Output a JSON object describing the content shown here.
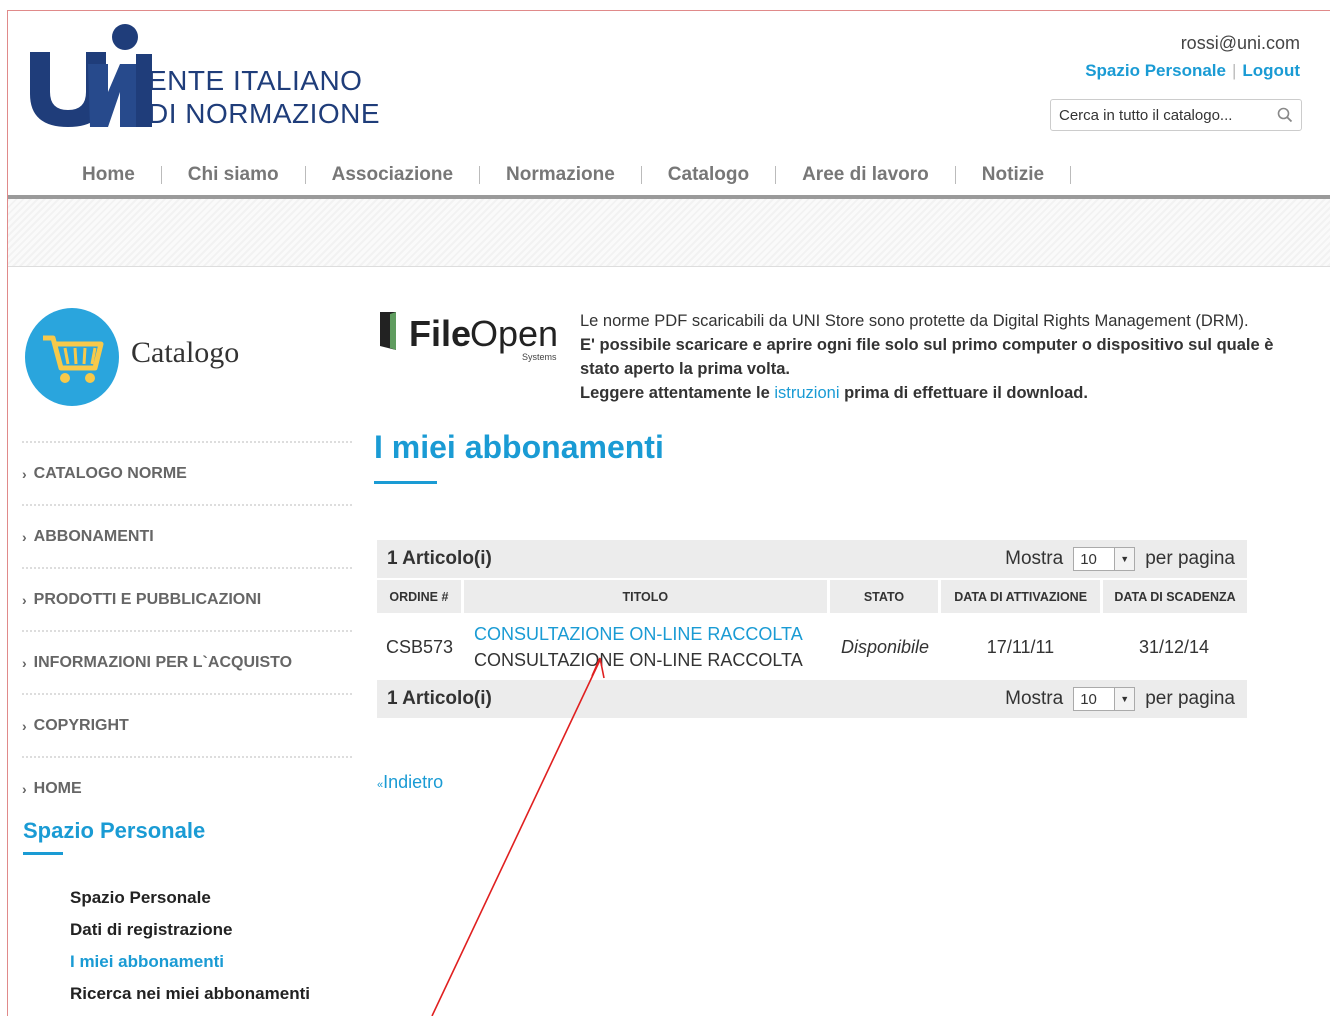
{
  "brand": {
    "line1": "ENTE ITALIANO",
    "line2": "DI NORMAZIONE",
    "brand_blue": "#1f3d7a"
  },
  "user": {
    "email": "rossi@uni.com",
    "personal_space": "Spazio Personale",
    "logout": "Logout"
  },
  "search": {
    "placeholder": "Cerca in tutto il catalogo..."
  },
  "nav": {
    "items": [
      "Home",
      "Chi siamo",
      "Associazione",
      "Normazione",
      "Catalogo",
      "Aree di lavoro",
      "Notizie"
    ]
  },
  "sidebar": {
    "catalog_title": "Catalogo",
    "menu": [
      "CATALOGO NORME",
      "ABBONAMENTI",
      "PRODOTTI E PUBBLICAZIONI",
      "INFORMAZIONI PER L`ACQUISTO",
      "COPYRIGHT",
      "HOME"
    ],
    "personal_title": "Spazio Personale",
    "personal_links": [
      "Spazio Personale",
      "Dati di registrazione",
      "I miei abbonamenti",
      "Ricerca nei miei abbonamenti"
    ],
    "active_link": "I miei abbonamenti"
  },
  "fileopen": {
    "brand_file": "File",
    "brand_open": "Open",
    "brand_sub": "Systems",
    "line1": "Le norme PDF scaricabili da UNI Store sono protette da Digital Rights Management (DRM).",
    "line2": "E' possibile scaricare e aprire ogni file solo sul primo computer o dispositivo sul quale è stato aperto la prima volta.",
    "line3_pre": "Leggere attentamente le ",
    "line3_link": "istruzioni",
    "line3_post": " prima di effettuare il download."
  },
  "main": {
    "title": "I miei abbonamenti",
    "pager": {
      "count": "1 Articolo(i)",
      "show": "Mostra",
      "per_page": "per pagina",
      "selected": "10"
    },
    "columns": [
      "ORDINE #",
      "TITOLO",
      "STATO",
      "DATA DI ATTIVAZIONE",
      "DATA DI SCADENZA"
    ],
    "rows": [
      {
        "order": "CSB573",
        "title_link": "CONSULTAZIONE ON-LINE RACCOLTA",
        "title_sub": "CONSULTAZIONE ON-LINE RACCOLTA",
        "status": "Disponibile",
        "activation": "17/11/11",
        "expiry": "31/12/14"
      }
    ],
    "back": "Indietro"
  },
  "colors": {
    "accent": "#1a9bd4",
    "annotation_arrow": "#e02020"
  }
}
